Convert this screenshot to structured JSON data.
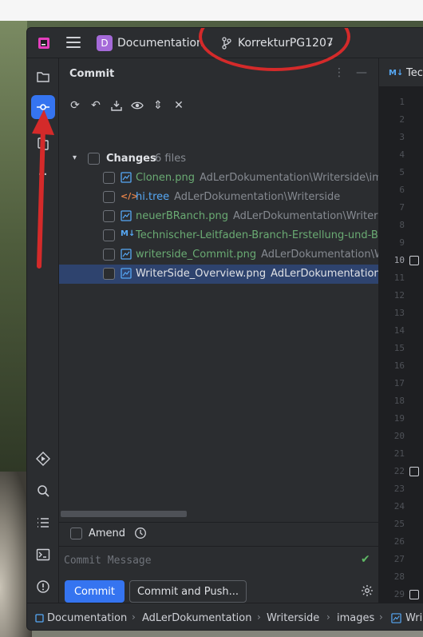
{
  "colors": {
    "accent": "#3574f0",
    "annotation": "#d42a2a",
    "vcs_added": "#6aab73",
    "vcs_modified": "#56a8f5"
  },
  "titlebar": {
    "project_badge": "D",
    "project_name": "Documentation",
    "branch_name": "KorrekturPG1207"
  },
  "toolstrip": {
    "items": [
      "folder-icon",
      "commit-icon",
      "pull-requests-icon",
      "more-icon",
      "run-icon",
      "search-icon",
      "todo-icon",
      "terminal-icon",
      "problems-icon",
      "git-icon"
    ]
  },
  "commit_panel": {
    "title": "Commit",
    "changes_label": "Changes",
    "changes_count": "6 files",
    "files": [
      {
        "name": "Clonen.png",
        "path": "AdLerDokumentation\\Writerside\\ima",
        "color": "green",
        "icon": "image-icon"
      },
      {
        "name": "hi.tree",
        "path": "AdLerDokumentation\\Writerside",
        "color": "blue",
        "icon": "xml-icon"
      },
      {
        "name": "neuerBRanch.png",
        "path": "AdLerDokumentation\\Writersi",
        "color": "green",
        "icon": "image-icon"
      },
      {
        "name": "Technischer-Leitfaden-Branch-Erstellung-und-B",
        "path": "",
        "color": "green",
        "icon": "markdown-icon"
      },
      {
        "name": "writerside_Commit.png",
        "path": "AdLerDokumentation\\Wr",
        "color": "green",
        "icon": "image-icon"
      },
      {
        "name": "WriterSide_Overview.png",
        "path": "AdLerDokumentation\\V",
        "color": "white",
        "icon": "image-icon"
      }
    ],
    "amend_label": "Amend",
    "message_placeholder": "Commit Message",
    "commit_button": "Commit",
    "commit_push_button": "Commit and Push..."
  },
  "editor": {
    "tab_icon": "M↓",
    "tab_label": "Tec",
    "line_numbers": [
      "1",
      "2",
      "3",
      "4",
      "5",
      "6",
      "7",
      "8",
      "9",
      "10",
      "11",
      "12",
      "13",
      "14",
      "15",
      "16",
      "17",
      "18",
      "19",
      "20",
      "21",
      "22",
      "23",
      "24",
      "25",
      "26",
      "27",
      "28",
      "29"
    ]
  },
  "statusbar": {
    "crumbs": [
      "Documentation",
      "AdLerDokumentation",
      "Writerside",
      "images",
      "Wri"
    ]
  }
}
